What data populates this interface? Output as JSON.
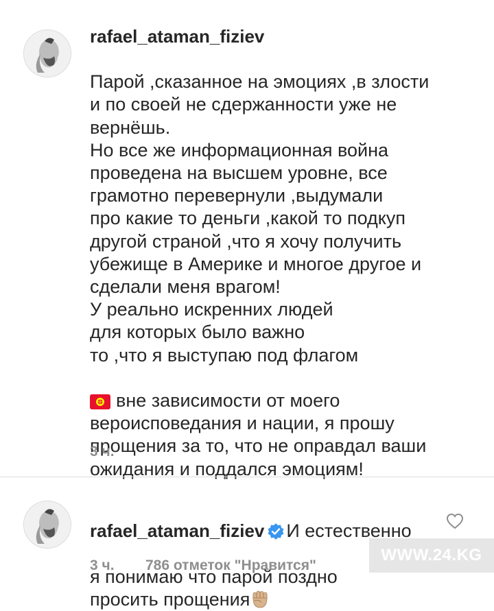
{
  "comments": [
    {
      "username": "rafael_ataman_fiziev",
      "text_part1": "Парой ,сказанное на эмоциях ,в злости\nи по своей не сдержанности уже не\nвернёшь.\nНо все же информационная война\nпроведена на высшем уровне, все\nграмотно перевернули ,выдумали\nпро какие то деньги ,какой то подкуп\nдругой страной ,что я хочу получить\nубежище в Америке и многое другое и\nсделали меня врагом!\nУ реально искренних людей\nдля которых было важно\nто ,что я выступаю под флагом",
      "text_part2": "вне зависимости от моего\nвероисповедания и нации, я прошу\nпрощения за то, что не оправдал ваши\nожидания и поддался эмоциям!",
      "time": "3 ч."
    },
    {
      "username": "rafael_ataman_fiziev",
      "text_first": "И естественно",
      "text_rest": "я понимаю что парой поздно\nпросить прощения",
      "time": "3 ч.",
      "likes": "786 отметок \"Нравится\""
    }
  ],
  "watermark": "WWW.24.KG",
  "icons": {
    "flag": "kyrgyzstan-flag-icon",
    "verified": "verified-badge-icon",
    "fist": "raised-fist-icon",
    "like": "heart-outline-icon"
  },
  "colors": {
    "text": "#262626",
    "meta": "#8e8e8e",
    "verified": "#3897f0",
    "flag_red": "#e8112d",
    "flag_sun": "#ffef00"
  }
}
